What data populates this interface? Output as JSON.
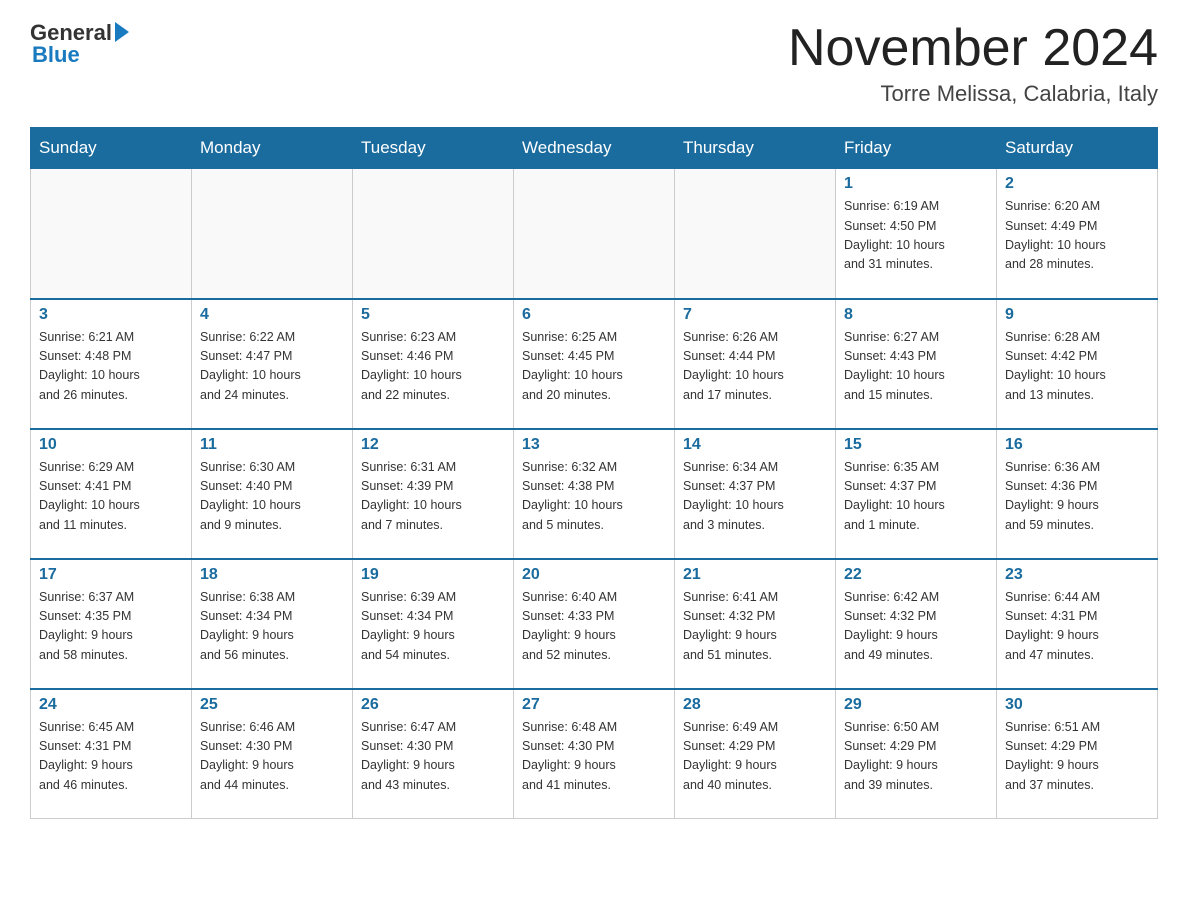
{
  "header": {
    "logo": {
      "general": "General",
      "blue": "Blue"
    },
    "title": "November 2024",
    "subtitle": "Torre Melissa, Calabria, Italy"
  },
  "weekdays": [
    "Sunday",
    "Monday",
    "Tuesday",
    "Wednesday",
    "Thursday",
    "Friday",
    "Saturday"
  ],
  "weeks": [
    [
      {
        "day": "",
        "info": ""
      },
      {
        "day": "",
        "info": ""
      },
      {
        "day": "",
        "info": ""
      },
      {
        "day": "",
        "info": ""
      },
      {
        "day": "",
        "info": ""
      },
      {
        "day": "1",
        "info": "Sunrise: 6:19 AM\nSunset: 4:50 PM\nDaylight: 10 hours\nand 31 minutes."
      },
      {
        "day": "2",
        "info": "Sunrise: 6:20 AM\nSunset: 4:49 PM\nDaylight: 10 hours\nand 28 minutes."
      }
    ],
    [
      {
        "day": "3",
        "info": "Sunrise: 6:21 AM\nSunset: 4:48 PM\nDaylight: 10 hours\nand 26 minutes."
      },
      {
        "day": "4",
        "info": "Sunrise: 6:22 AM\nSunset: 4:47 PM\nDaylight: 10 hours\nand 24 minutes."
      },
      {
        "day": "5",
        "info": "Sunrise: 6:23 AM\nSunset: 4:46 PM\nDaylight: 10 hours\nand 22 minutes."
      },
      {
        "day": "6",
        "info": "Sunrise: 6:25 AM\nSunset: 4:45 PM\nDaylight: 10 hours\nand 20 minutes."
      },
      {
        "day": "7",
        "info": "Sunrise: 6:26 AM\nSunset: 4:44 PM\nDaylight: 10 hours\nand 17 minutes."
      },
      {
        "day": "8",
        "info": "Sunrise: 6:27 AM\nSunset: 4:43 PM\nDaylight: 10 hours\nand 15 minutes."
      },
      {
        "day": "9",
        "info": "Sunrise: 6:28 AM\nSunset: 4:42 PM\nDaylight: 10 hours\nand 13 minutes."
      }
    ],
    [
      {
        "day": "10",
        "info": "Sunrise: 6:29 AM\nSunset: 4:41 PM\nDaylight: 10 hours\nand 11 minutes."
      },
      {
        "day": "11",
        "info": "Sunrise: 6:30 AM\nSunset: 4:40 PM\nDaylight: 10 hours\nand 9 minutes."
      },
      {
        "day": "12",
        "info": "Sunrise: 6:31 AM\nSunset: 4:39 PM\nDaylight: 10 hours\nand 7 minutes."
      },
      {
        "day": "13",
        "info": "Sunrise: 6:32 AM\nSunset: 4:38 PM\nDaylight: 10 hours\nand 5 minutes."
      },
      {
        "day": "14",
        "info": "Sunrise: 6:34 AM\nSunset: 4:37 PM\nDaylight: 10 hours\nand 3 minutes."
      },
      {
        "day": "15",
        "info": "Sunrise: 6:35 AM\nSunset: 4:37 PM\nDaylight: 10 hours\nand 1 minute."
      },
      {
        "day": "16",
        "info": "Sunrise: 6:36 AM\nSunset: 4:36 PM\nDaylight: 9 hours\nand 59 minutes."
      }
    ],
    [
      {
        "day": "17",
        "info": "Sunrise: 6:37 AM\nSunset: 4:35 PM\nDaylight: 9 hours\nand 58 minutes."
      },
      {
        "day": "18",
        "info": "Sunrise: 6:38 AM\nSunset: 4:34 PM\nDaylight: 9 hours\nand 56 minutes."
      },
      {
        "day": "19",
        "info": "Sunrise: 6:39 AM\nSunset: 4:34 PM\nDaylight: 9 hours\nand 54 minutes."
      },
      {
        "day": "20",
        "info": "Sunrise: 6:40 AM\nSunset: 4:33 PM\nDaylight: 9 hours\nand 52 minutes."
      },
      {
        "day": "21",
        "info": "Sunrise: 6:41 AM\nSunset: 4:32 PM\nDaylight: 9 hours\nand 51 minutes."
      },
      {
        "day": "22",
        "info": "Sunrise: 6:42 AM\nSunset: 4:32 PM\nDaylight: 9 hours\nand 49 minutes."
      },
      {
        "day": "23",
        "info": "Sunrise: 6:44 AM\nSunset: 4:31 PM\nDaylight: 9 hours\nand 47 minutes."
      }
    ],
    [
      {
        "day": "24",
        "info": "Sunrise: 6:45 AM\nSunset: 4:31 PM\nDaylight: 9 hours\nand 46 minutes."
      },
      {
        "day": "25",
        "info": "Sunrise: 6:46 AM\nSunset: 4:30 PM\nDaylight: 9 hours\nand 44 minutes."
      },
      {
        "day": "26",
        "info": "Sunrise: 6:47 AM\nSunset: 4:30 PM\nDaylight: 9 hours\nand 43 minutes."
      },
      {
        "day": "27",
        "info": "Sunrise: 6:48 AM\nSunset: 4:30 PM\nDaylight: 9 hours\nand 41 minutes."
      },
      {
        "day": "28",
        "info": "Sunrise: 6:49 AM\nSunset: 4:29 PM\nDaylight: 9 hours\nand 40 minutes."
      },
      {
        "day": "29",
        "info": "Sunrise: 6:50 AM\nSunset: 4:29 PM\nDaylight: 9 hours\nand 39 minutes."
      },
      {
        "day": "30",
        "info": "Sunrise: 6:51 AM\nSunset: 4:29 PM\nDaylight: 9 hours\nand 37 minutes."
      }
    ]
  ]
}
